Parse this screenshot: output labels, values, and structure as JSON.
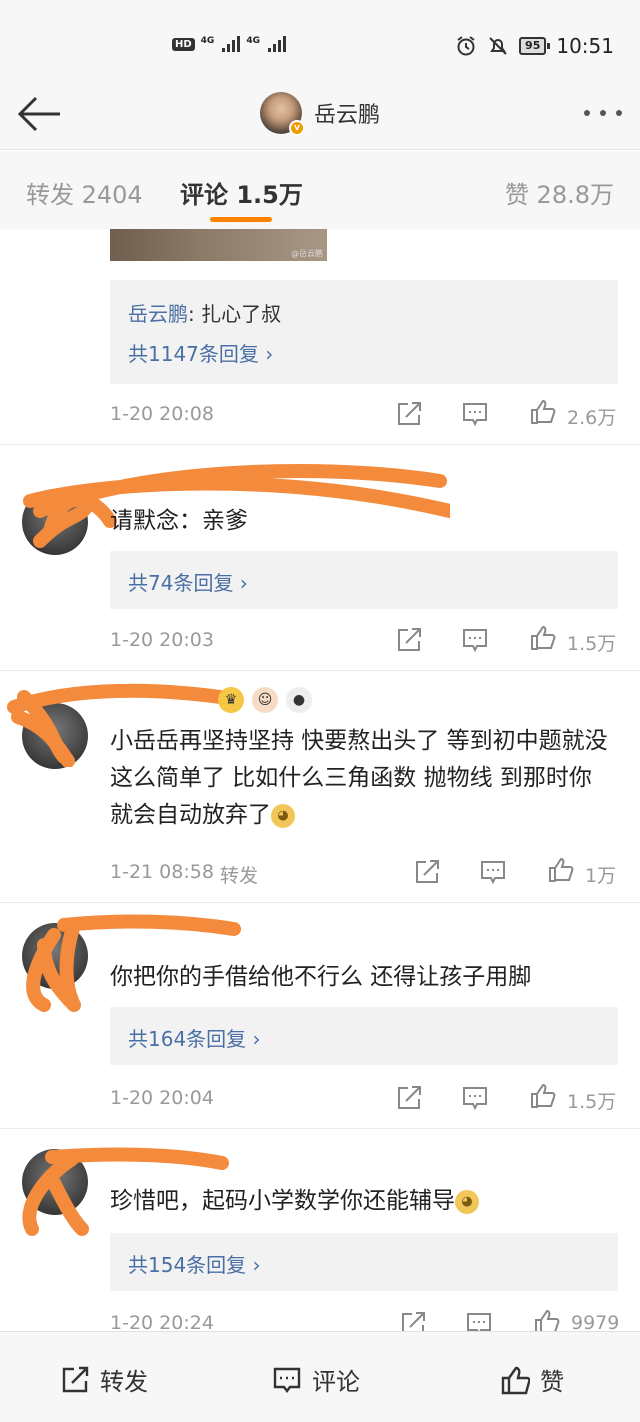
{
  "status_bar": {
    "network_badge": "HD",
    "signal_label_1": "4G",
    "signal_label_2": "4G",
    "battery": "95",
    "time": "10:51"
  },
  "header": {
    "title": "岳云鹏",
    "verified_badge": "v"
  },
  "tabs": [
    {
      "label": "转发 2404"
    },
    {
      "label": "评论 1.5万"
    },
    {
      "label": "赞 28.8万"
    }
  ],
  "accent_color": "#ff8200",
  "link_color": "#4a6fa5",
  "image_watermark": "@岳云鹏",
  "comments": [
    {
      "reply_author": "岳云鹏",
      "reply_text": ": 扎心了叔",
      "reply_count": "共1147条回复 ›",
      "time": "1-20 20:08",
      "likes": "2.6万"
    },
    {
      "text": "请默念：亲爹",
      "reply_count": "共74条回复 ›",
      "time": "1-20 20:03",
      "likes": "1.5万"
    },
    {
      "text": "小岳岳再坚持坚持 快要熬出头了 等到初中题就没这么简单了 比如什么三角函数 抛物线 到那时你就会自动放弃了",
      "emoji": "doge",
      "time": "1-21 08:58",
      "forward": "转发",
      "likes": "1万"
    },
    {
      "text": "你把你的手借给他不行么 还得让孩子用脚",
      "reply_count": "共164条回复 ›",
      "time": "1-20 20:04",
      "likes": "1.5万"
    },
    {
      "text": "珍惜吧，起码小学数学你还能辅导",
      "emoji": "doge",
      "reply_count": "共154条回复 ›",
      "time": "1-20 20:24",
      "likes": "9979"
    }
  ],
  "bottom_bar": {
    "forward": "转发",
    "comment": "评论",
    "like": "赞"
  }
}
